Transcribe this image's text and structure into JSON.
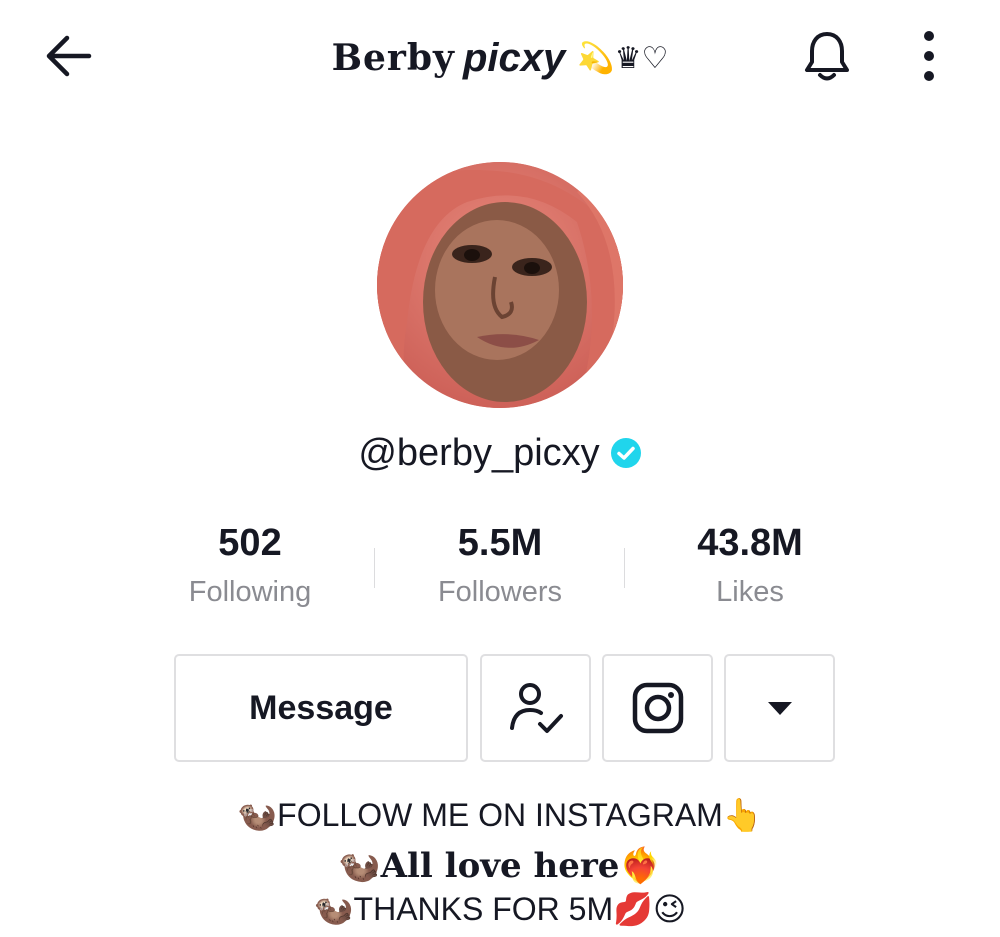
{
  "header": {
    "title_part1": "Berby",
    "title_part2": "picxy",
    "title_decor": "💫♛♡"
  },
  "profile": {
    "handle": "@berby_picxy",
    "verified": true,
    "verified_color": "#20d5ec"
  },
  "stats": {
    "following": {
      "value": "502",
      "label": "Following"
    },
    "followers": {
      "value": "5.5M",
      "label": "Followers"
    },
    "likes": {
      "value": "43.8M",
      "label": "Likes"
    }
  },
  "actions": {
    "message_label": "Message",
    "friend_icon": "person-check-icon",
    "instagram_icon": "instagram-icon",
    "dropdown_icon": "caret-down-icon"
  },
  "bio": {
    "line1": "🦦FOLLOW ME ON INSTAGRAM👆",
    "line2": "🦦All love here❤️‍🔥",
    "line3": "🦦THANKS FOR 5M💋😉"
  }
}
